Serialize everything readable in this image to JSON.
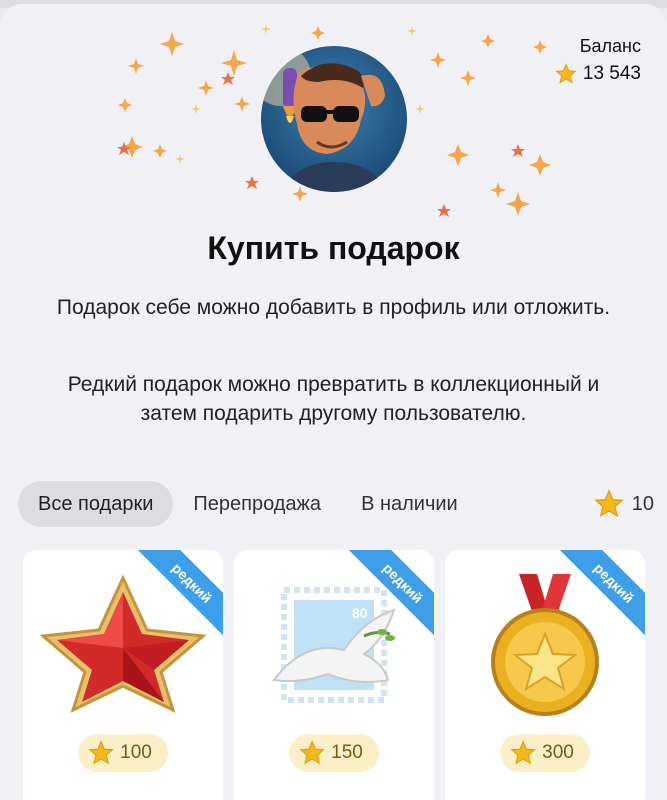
{
  "balance": {
    "label": "Баланс",
    "amount": "13 543",
    "icon": "star-icon"
  },
  "header": {
    "title": "Купить подарок",
    "description1": "Подарок себе можно добавить в профиль или отложить.",
    "description2": "Редкий подарок можно превратить в коллекционный и затем подарить другому пользователю."
  },
  "tabs": [
    {
      "label": "Все подарки",
      "active": true
    },
    {
      "label": "Перепродажа",
      "active": false
    },
    {
      "label": "В наличии",
      "active": false
    }
  ],
  "stars_filter": {
    "value": "10",
    "icon": "star-icon"
  },
  "gifts": [
    {
      "name": "red-star-gift",
      "badge": "редкий",
      "price": "100"
    },
    {
      "name": "dove-stamp-gift",
      "badge": "редкий",
      "price": "150"
    },
    {
      "name": "gold-medal-gift",
      "badge": "редкий",
      "price": "300"
    }
  ],
  "colors": {
    "accent": "#3e9ee8",
    "star": "#f5b81c",
    "price_bg": "#fbefc8"
  }
}
